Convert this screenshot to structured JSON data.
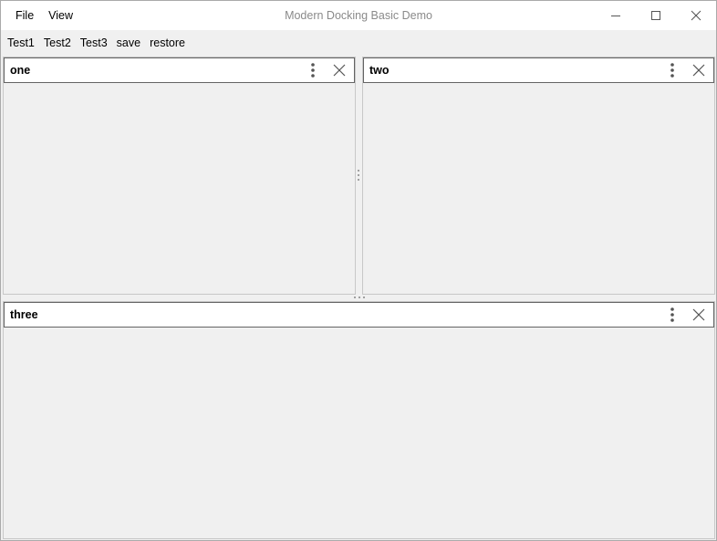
{
  "window": {
    "title": "Modern Docking Basic Demo"
  },
  "menu": {
    "items": [
      {
        "label": "File"
      },
      {
        "label": "View"
      }
    ]
  },
  "toolbar": {
    "buttons": [
      {
        "label": "Test1"
      },
      {
        "label": "Test2"
      },
      {
        "label": "Test3"
      },
      {
        "label": "save"
      },
      {
        "label": "restore"
      }
    ]
  },
  "dockables": [
    {
      "title": "one"
    },
    {
      "title": "two"
    },
    {
      "title": "three"
    }
  ],
  "icons": {
    "minimize": "minimize-icon",
    "maximize": "maximize-icon",
    "close": "close-icon",
    "options": "vertical-ellipsis-icon"
  },
  "colors": {
    "background": "#f0f0f0",
    "header_border": "#646464",
    "title_text": "#8a8a8a"
  }
}
